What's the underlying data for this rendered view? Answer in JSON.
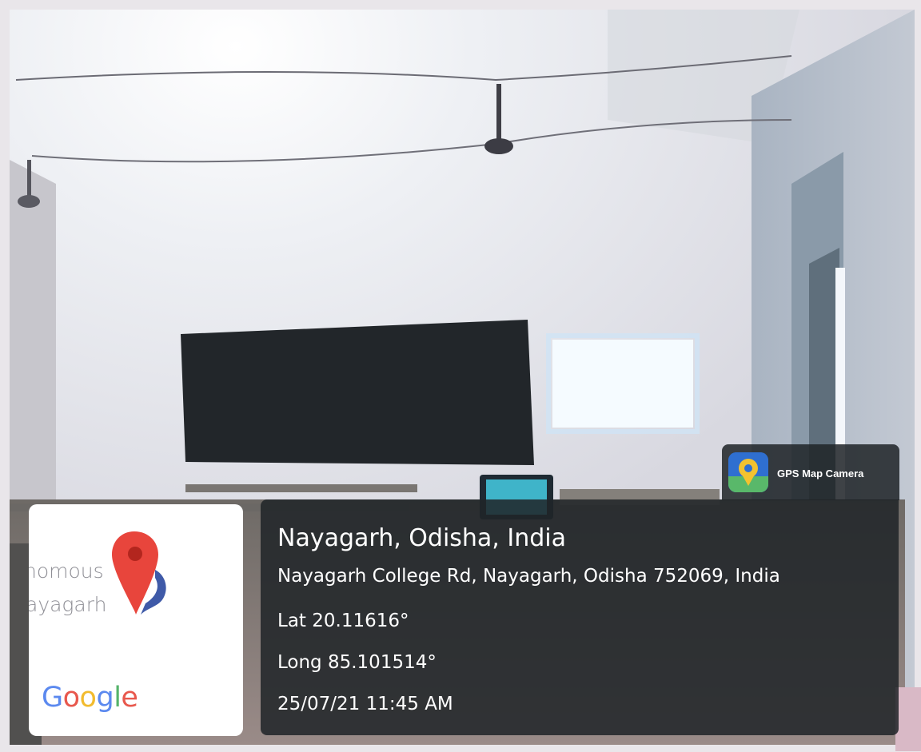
{
  "map_thumbnail": {
    "partial_text_1": "nomous",
    "partial_text_2": "ayagarh",
    "google_logo": {
      "g1": "G",
      "o1": "o",
      "o2": "o",
      "g2": "g",
      "l": "l",
      "e": "e"
    },
    "pin_icon": "map-pin-icon",
    "pin_color": "#ea4335"
  },
  "app_badge": {
    "icon": "gps-map-camera-icon",
    "name": "GPS Map Camera"
  },
  "location_info": {
    "title": "Nayagarh, Odisha, India",
    "address": "Nayagarh College Rd, Nayagarh, Odisha 752069, India",
    "latitude": "Lat 20.11616°",
    "longitude": "Long 85.101514°",
    "timestamp": "25/07/21 11:45 AM"
  }
}
